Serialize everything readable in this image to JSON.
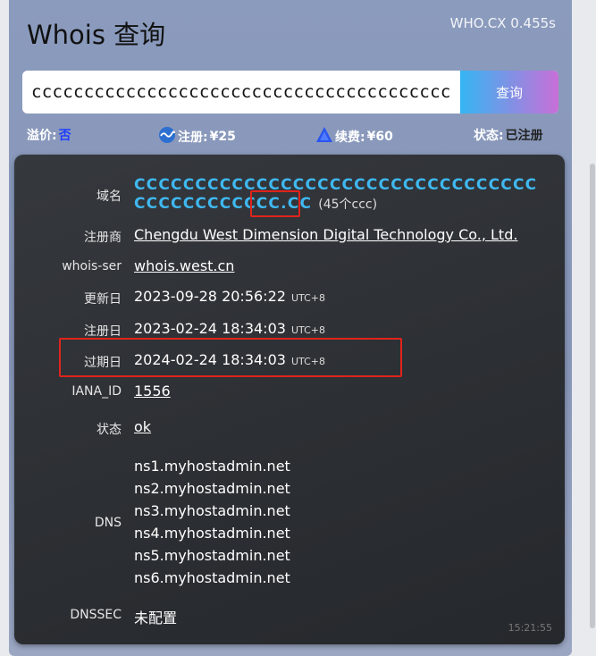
{
  "header": {
    "title": "Whois 查询",
    "meta": "WHO.CX 0.455s"
  },
  "search": {
    "value": "ccccccccccccccccccccccccccccccccccccccccccccc",
    "button_label": "查询"
  },
  "stats": {
    "premium_label": "溢价:",
    "premium_value": "否",
    "register_label": "注册:",
    "register_value": "¥25",
    "renew_label": "续费:",
    "renew_value": "¥60",
    "status_label": "状态:",
    "status_value": "已注册"
  },
  "result": {
    "domain_label": "域名",
    "domain_value": "CCCCCCCCCCCCCCCCCCCCCCCCCCCCCCCCCCCCCCCCCCCCC.CC",
    "domain_count_open": "(45个c",
    "domain_count_close": "cc)",
    "registrar_label": "注册商",
    "registrar_value": "Chengdu West Dimension Digital Technology Co., Ltd.",
    "whois_label": "whois-ser",
    "whois_value": "whois.west.cn",
    "updated_label": "更新日",
    "updated_value": "2023-09-28 20:56:22",
    "created_label": "注册日",
    "created_value": "2023-02-24 18:34:03",
    "expires_label": "过期日",
    "expires_value": "2024-02-24 18:34:03",
    "tz": "UTC+8",
    "iana_label": "IANA_ID",
    "iana_value": "1556",
    "status_label": "状态",
    "status_value": "ok",
    "dns_label": "DNS",
    "dns": [
      "ns1.myhostadmin.net",
      "ns2.myhostadmin.net",
      "ns3.myhostadmin.net",
      "ns4.myhostadmin.net",
      "ns5.myhostadmin.net",
      "ns6.myhostadmin.net"
    ],
    "dnssec_label": "DNSSEC",
    "dnssec_value": "未配置",
    "clock": "15:21:55"
  },
  "colors": {
    "accent_blue": "#3fb8f0",
    "highlight_red": "#e0241c",
    "button_start": "#35b5f2",
    "button_end": "#c86fd8"
  }
}
